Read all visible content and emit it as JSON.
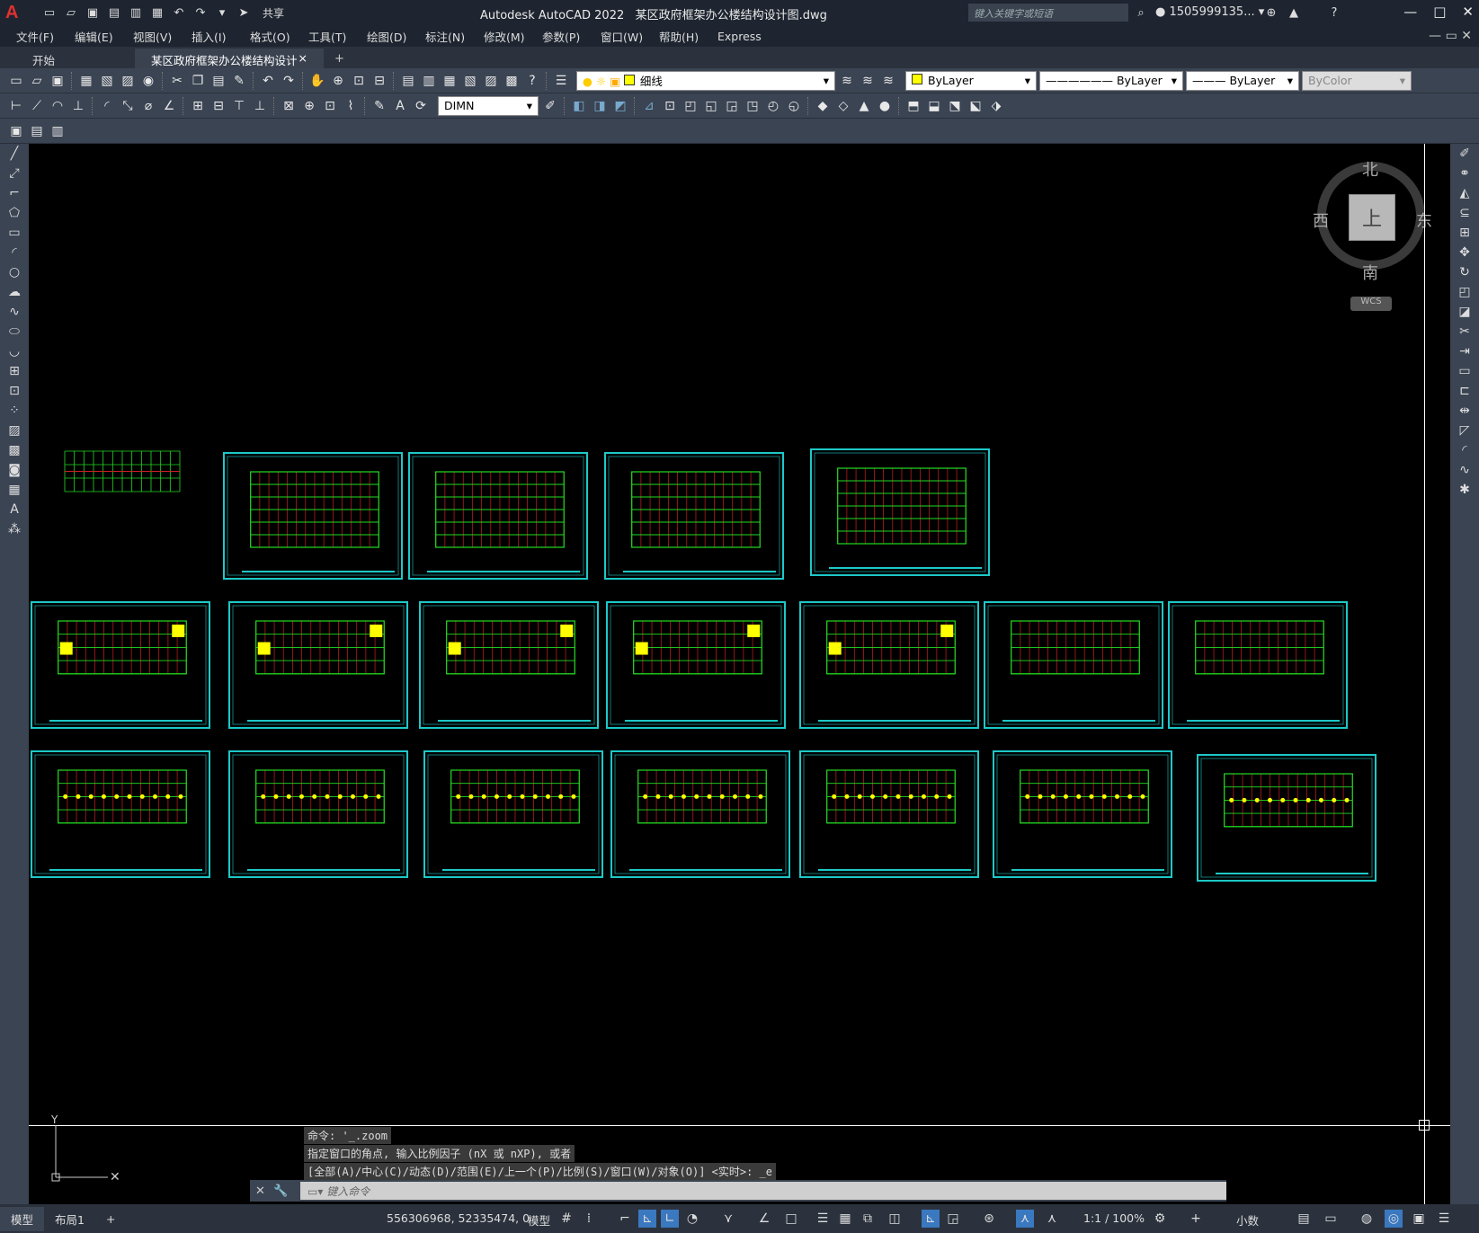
{
  "app": {
    "title": "Autodesk AutoCAD 2022",
    "file": "某区政府框架办公楼结构设计图.dwg",
    "share": "共享",
    "search_placeholder": "键入关键字或短语",
    "user": "1505999135..."
  },
  "menu": [
    "文件(F)",
    "编辑(E)",
    "视图(V)",
    "插入(I)",
    "格式(O)",
    "工具(T)",
    "绘图(D)",
    "标注(N)",
    "修改(M)",
    "参数(P)",
    "窗口(W)",
    "帮助(H)",
    "Express"
  ],
  "tabs": {
    "start": "开始",
    "active": "某区政府框架办公楼结构设计图*",
    "close": "×",
    "add": "+"
  },
  "props": {
    "layer": "细线",
    "color": "ByLayer",
    "linetype": "ByLayer",
    "lineweight": "ByLayer",
    "plotstyle": "ByColor",
    "dimstyle": "DIMN"
  },
  "viewcube": {
    "north": "北",
    "south": "南",
    "east": "东",
    "west": "西",
    "top": "上",
    "wcs": "WCS"
  },
  "command": {
    "history": [
      "命令: '_.zoom",
      "指定窗口的角点, 输入比例因子 (nX 或 nXP), 或者",
      "[全部(A)/中心(C)/动态(D)/范围(E)/上一个(P)/比例(S)/窗口(W)/对象(O)] <实时>: _e"
    ],
    "placeholder": "键入命令"
  },
  "status": {
    "model_tab": "模型",
    "layout_tab": "布局1",
    "add": "+",
    "coords": "556306968, 52335474, 0",
    "mode": "模型",
    "scale": "1:1 / 100%",
    "units": "小数"
  },
  "colors": {
    "sheet_border": "#1ec8c8",
    "grid": "#22dd22",
    "beam": "#cc2020",
    "highlight": "#ffff00"
  }
}
